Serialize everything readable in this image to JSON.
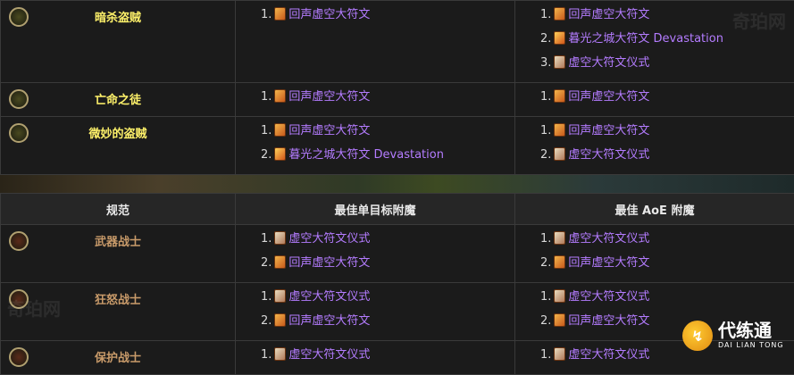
{
  "rogue_table": {
    "rows": [
      {
        "spec": "暗杀盗贼",
        "icon": "crossed-daggers-icon",
        "single": [
          {
            "n": "1.",
            "rune": "echo",
            "name": "回声虚空大符文"
          }
        ],
        "aoe": [
          {
            "n": "1.",
            "rune": "echo",
            "name": "回声虚空大符文"
          },
          {
            "n": "2.",
            "rune": "dawn",
            "name": "暮光之城大符文 Devastation"
          },
          {
            "n": "3.",
            "rune": "ritual",
            "name": "虚空大符文仪式"
          }
        ]
      },
      {
        "spec": "亡命之徒",
        "icon": "pirate-skull-icon",
        "single": [
          {
            "n": "1.",
            "rune": "echo",
            "name": "回声虚空大符文"
          }
        ],
        "aoe": [
          {
            "n": "1.",
            "rune": "echo",
            "name": "回声虚空大符文"
          }
        ]
      },
      {
        "spec": "微妙的盗贼",
        "icon": "shadow-dagger-icon",
        "single": [
          {
            "n": "1.",
            "rune": "echo",
            "name": "回声虚空大符文"
          },
          {
            "n": "2.",
            "rune": "dawn",
            "name": "暮光之城大符文 Devastation"
          }
        ],
        "aoe": [
          {
            "n": "1.",
            "rune": "echo",
            "name": "回声虚空大符文"
          },
          {
            "n": "2.",
            "rune": "ritual",
            "name": "虚空大符文仪式"
          }
        ]
      }
    ]
  },
  "warrior_table": {
    "headers": {
      "spec": "规范",
      "single": "最佳单目标附魔",
      "aoe": "最佳 AoE 附魔"
    },
    "rows": [
      {
        "spec": "武器战士",
        "icon": "sword-icon",
        "single": [
          {
            "n": "1.",
            "rune": "ritual",
            "name": "虚空大符文仪式"
          },
          {
            "n": "2.",
            "rune": "echo",
            "name": "回声虚空大符文"
          }
        ],
        "aoe": [
          {
            "n": "1.",
            "rune": "ritual",
            "name": "虚空大符文仪式"
          },
          {
            "n": "2.",
            "rune": "echo",
            "name": "回声虚空大符文"
          }
        ]
      },
      {
        "spec": "狂怒战士",
        "icon": "fury-axe-icon",
        "single": [
          {
            "n": "1.",
            "rune": "ritual",
            "name": "虚空大符文仪式"
          },
          {
            "n": "2.",
            "rune": "echo",
            "name": "回声虚空大符文"
          }
        ],
        "aoe": [
          {
            "n": "1.",
            "rune": "ritual",
            "name": "虚空大符文仪式"
          },
          {
            "n": "2.",
            "rune": "echo",
            "name": "回声虚空大符文"
          }
        ]
      },
      {
        "spec": "保护战士",
        "icon": "shield-icon",
        "single": [
          {
            "n": "1.",
            "rune": "ritual",
            "name": "虚空大符文仪式"
          }
        ],
        "aoe": [
          {
            "n": "1.",
            "rune": "ritual",
            "name": "虚空大符文仪式"
          }
        ]
      }
    ]
  },
  "watermarks": [
    "奇珀网",
    "奇珀网"
  ],
  "logo": {
    "mark": "↯",
    "cn": "代练通",
    "en": "DAI LIAN TONG"
  },
  "colors": {
    "rogue": "#fff26a",
    "warrior": "#c99b6a",
    "enchant": "#b47cff"
  }
}
